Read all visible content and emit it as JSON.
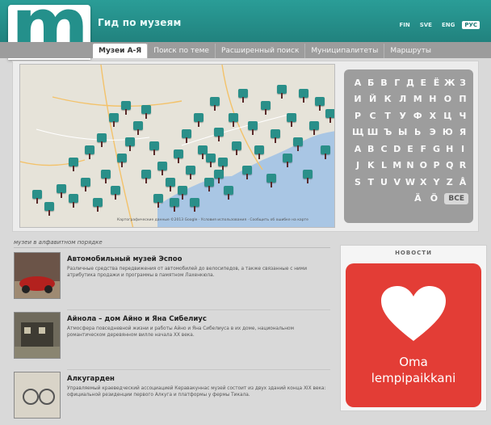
{
  "header": {
    "logo_letter": "m",
    "title": "Гид по музеям",
    "languages": [
      "FIN",
      "SVE",
      "ENG",
      "РУС"
    ],
    "active_language": "РУС"
  },
  "nav": {
    "tabs": [
      "Музеи А-Я",
      "Поиск по теме",
      "Расширенный поиск",
      "Муниципалитеты",
      "Маршруты"
    ],
    "active": "Музеи А-Я"
  },
  "map": {
    "attribution": "Картографические данные ©2013 Google · Условия использования · Сообщить об ошибке на карте"
  },
  "alphabet": {
    "rows": [
      [
        "А",
        "Б",
        "В",
        "Г",
        "Д",
        "Е",
        "Ё",
        "Ж",
        "З"
      ],
      [
        "И",
        "Й",
        "К",
        "Л",
        "М",
        "Н",
        "О",
        "П"
      ],
      [
        "Р",
        "С",
        "Т",
        "У",
        "Ф",
        "Х",
        "Ц",
        "Ч"
      ],
      [
        "Щ",
        "Ш",
        "Ъ",
        "Ы",
        "Ь",
        "Э",
        "Ю",
        "Я"
      ],
      [
        "A",
        "B",
        "C",
        "D",
        "E",
        "F",
        "G",
        "H",
        "I"
      ],
      [
        "J",
        "K",
        "L",
        "M",
        "N",
        "O",
        "P",
        "Q",
        "R"
      ],
      [
        "S",
        "T",
        "U",
        "V",
        "W",
        "X",
        "Y",
        "Z",
        "Å"
      ],
      [
        "Ä",
        "Ö"
      ]
    ],
    "all_label": "ВСЕ"
  },
  "list": {
    "title": "музеи в алфавитном порядке",
    "items": [
      {
        "title": "Автомобильный музей Эспоо",
        "desc": "Различные средства передвижения от автомобилей до велосипедов, а также связанные с ними атрибутика продажи и программы в памятном Лахенкюла."
      },
      {
        "title": "Айнола – дом Айно и Яна Сибелиус",
        "desc": "Атмосфера повседневной жизни и работы Айно и Яна Сибелиуса в их доме, национальном романтическом деревянном вилле начала XX века."
      },
      {
        "title": "Алкугарден",
        "desc": "Управляемый краеведческий ассоциацией Керавакуннас музей состоит из двух зданий конца XIX века: официальной резиденции первого Алкуга и платформы у фермы Тикала."
      }
    ]
  },
  "news": {
    "title": "НОВОСТИ",
    "card_text_line1": "Oma",
    "card_text_line2": "lempipaikkani"
  },
  "colors": {
    "brand": "#24908b",
    "nav": "#9c9c9c",
    "news_card": "#e33d36"
  }
}
